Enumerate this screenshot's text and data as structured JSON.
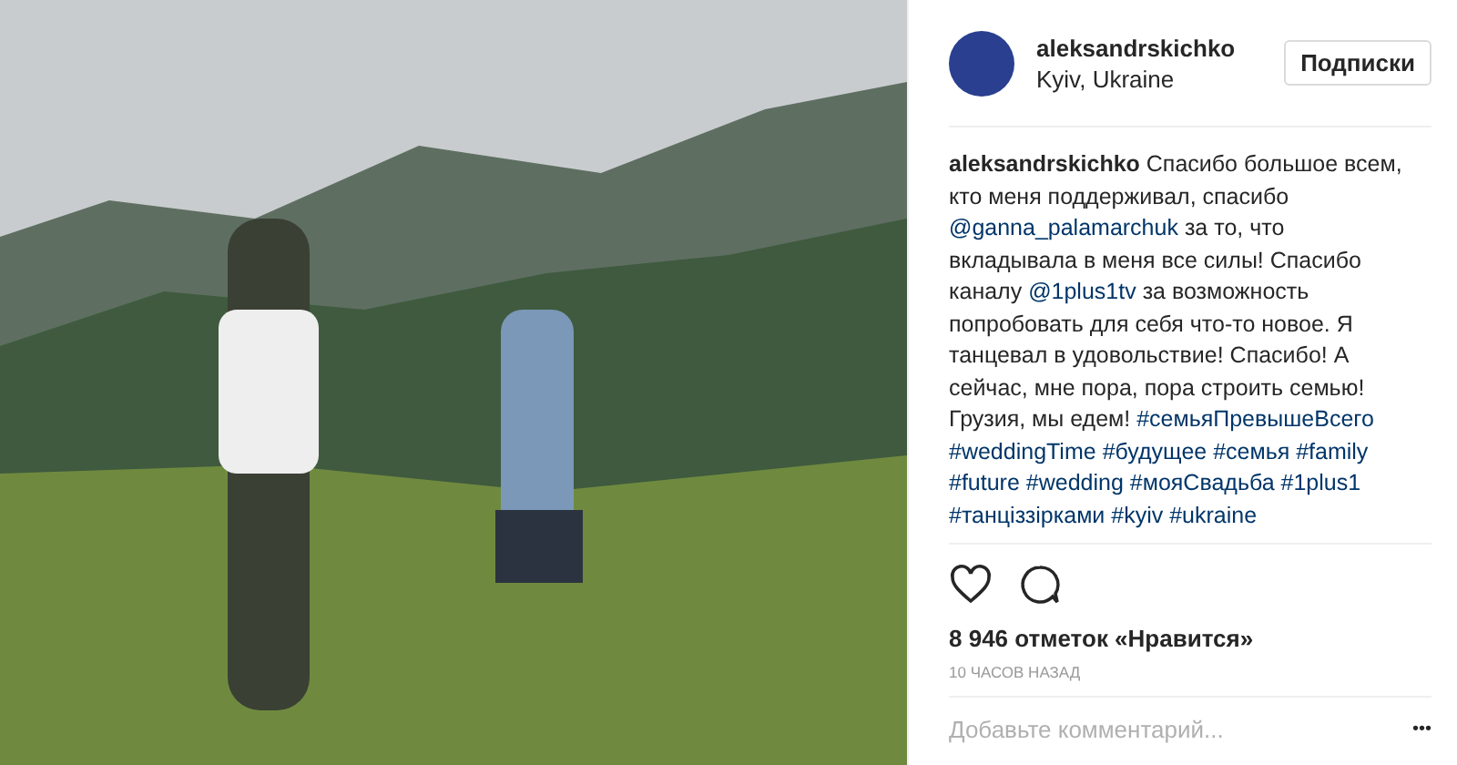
{
  "photo": {
    "kind": "landscape"
  },
  "header": {
    "username": "aleksandrskichko",
    "location": "Kyiv, Ukraine",
    "follow_button": "Подписки"
  },
  "caption": [
    {
      "kind": "user",
      "text": "aleksandrskichko"
    },
    {
      "kind": "text",
      "text": "Спасибо большое всем, кто меня поддерживал, спасибо"
    },
    {
      "kind": "link",
      "text": "@ganna_palamarchuk"
    },
    {
      "kind": "text",
      "text": "за то, что вкладывала в меня все силы! Спасибо каналу"
    },
    {
      "kind": "link",
      "text": "@1plus1tv"
    },
    {
      "kind": "text",
      "text": "за возможность попробовать для себя что-то новое. Я танцевал в удовольствие! Спасибо! А сейчас, мне пора, пора строить семью! Грузия, мы едем!"
    },
    {
      "kind": "link",
      "text": "#семьяПревышеВсего"
    },
    {
      "kind": "link",
      "text": "#weddingTime"
    },
    {
      "kind": "link",
      "text": "#будущее"
    },
    {
      "kind": "link",
      "text": "#семья"
    },
    {
      "kind": "link",
      "text": "#family"
    },
    {
      "kind": "link",
      "text": "#future"
    },
    {
      "kind": "link",
      "text": "#wedding"
    },
    {
      "kind": "link",
      "text": "#мояСвадьба"
    },
    {
      "kind": "link",
      "text": "#1plus1"
    },
    {
      "kind": "link",
      "text": "#танціззірками"
    },
    {
      "kind": "link",
      "text": "#kyiv"
    },
    {
      "kind": "link",
      "text": "#ukraine"
    }
  ],
  "likes": "8 946 отметок «Нравится»",
  "time": "10 ЧАСОВ НАЗАД",
  "comment": {
    "placeholder": "Добавьте комментарий...",
    "more": "•••"
  }
}
